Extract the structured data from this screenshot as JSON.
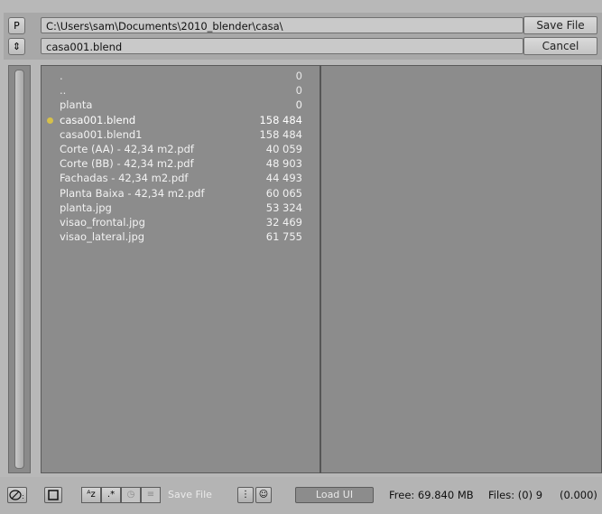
{
  "header": {
    "p_button_label": "P",
    "parent_button_label": "⇕",
    "directory_path": "C:\\Users\\sam\\Documents\\2010_blender\\casa\\",
    "filename": "casa001.blend",
    "save_label": "Save File",
    "cancel_label": "Cancel"
  },
  "files": [
    {
      "name": ".",
      "size": "0",
      "selected": false
    },
    {
      "name": "..",
      "size": "0",
      "selected": false
    },
    {
      "name": "planta",
      "size": "0",
      "selected": false
    },
    {
      "name": "casa001.blend",
      "size": "158 484",
      "selected": true
    },
    {
      "name": "casa001.blend1",
      "size": "158 484",
      "selected": false
    },
    {
      "name": "Corte (AA) - 42,34 m2.pdf",
      "size": "40 059",
      "selected": false
    },
    {
      "name": "Corte (BB) - 42,34 m2.pdf",
      "size": "48 903",
      "selected": false
    },
    {
      "name": "Fachadas - 42,34 m2.pdf",
      "size": "44 493",
      "selected": false
    },
    {
      "name": "Planta Baixa - 42,34 m2.pdf",
      "size": "60 065",
      "selected": false
    },
    {
      "name": "planta.jpg",
      "size": "53 324",
      "selected": false
    },
    {
      "name": "visao_frontal.jpg",
      "size": "32 469",
      "selected": false
    },
    {
      "name": "visao_lateral.jpg",
      "size": "61 755",
      "selected": false
    }
  ],
  "footer": {
    "save_file_label": "Save File",
    "load_ui_label": "Load UI",
    "free_space": "Free: 69.840 MB",
    "files_count": "Files: (0) 9",
    "selected_size": "(0.000)"
  },
  "colors": {
    "panel_bg": "#8c8c8c",
    "selected_dot": "#d6c04a",
    "file_text": "#f2f2f2"
  }
}
